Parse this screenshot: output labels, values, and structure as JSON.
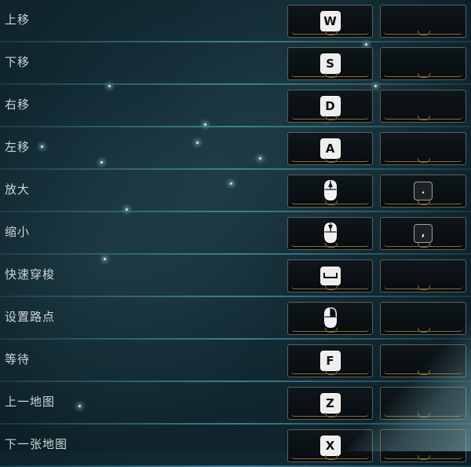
{
  "keybindings": [
    {
      "label": "上移",
      "primary": {
        "type": "key",
        "key": "W"
      },
      "secondary": {
        "type": "empty"
      }
    },
    {
      "label": "下移",
      "primary": {
        "type": "key",
        "key": "S"
      },
      "secondary": {
        "type": "empty"
      }
    },
    {
      "label": "右移",
      "primary": {
        "type": "key",
        "key": "D"
      },
      "secondary": {
        "type": "empty"
      }
    },
    {
      "label": "左移",
      "primary": {
        "type": "key",
        "key": "A"
      },
      "secondary": {
        "type": "empty"
      }
    },
    {
      "label": "放大",
      "primary": {
        "type": "icon",
        "icon": "mouse-scroll-up-icon"
      },
      "secondary": {
        "type": "key",
        "key": "."
      }
    },
    {
      "label": "缩小",
      "primary": {
        "type": "icon",
        "icon": "mouse-scroll-down-icon"
      },
      "secondary": {
        "type": "key",
        "key": ","
      }
    },
    {
      "label": "快速穿梭",
      "primary": {
        "type": "icon",
        "icon": "spacebar-icon"
      },
      "secondary": {
        "type": "empty"
      }
    },
    {
      "label": "设置路点",
      "primary": {
        "type": "icon",
        "icon": "mouse-right-click-icon"
      },
      "secondary": {
        "type": "empty"
      }
    },
    {
      "label": "等待",
      "primary": {
        "type": "key",
        "key": "F"
      },
      "secondary": {
        "type": "empty"
      }
    },
    {
      "label": "上一地图",
      "primary": {
        "type": "key",
        "key": "Z"
      },
      "secondary": {
        "type": "empty"
      }
    },
    {
      "label": "下一张地图",
      "primary": {
        "type": "key",
        "key": "X"
      },
      "secondary": {
        "type": "empty"
      }
    }
  ],
  "colors": {
    "background": "#122a33",
    "row_divider": "#468c9b",
    "label_text": "#cfd6d8",
    "slot_border": "#5b5f5d",
    "slot_ornament": "#8a6b2f",
    "keycap": "#eeeeee"
  }
}
